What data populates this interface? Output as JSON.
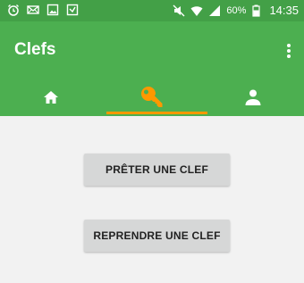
{
  "statusbar": {
    "left_icons": [
      "alarm-icon",
      "mail-icon",
      "image-icon",
      "vibrate-icon"
    ],
    "right_icons": [
      "mute-icon",
      "wifi-icon",
      "signal-icon",
      "battery-icon"
    ],
    "battery_percent": "60%",
    "time": "14:35"
  },
  "appbar": {
    "title": "Clefs",
    "overflow_icon": "more-vert-icon",
    "background": "#4caf50"
  },
  "tabs": [
    {
      "icon": "home-icon",
      "selected": false
    },
    {
      "icon": "key-icon",
      "selected": true
    },
    {
      "icon": "person-icon",
      "selected": false
    }
  ],
  "accent": "#ff9800",
  "actions": {
    "lend_label": "PRÊTER UNE CLEF",
    "return_label": "REPRENDRE UNE CLEF"
  }
}
